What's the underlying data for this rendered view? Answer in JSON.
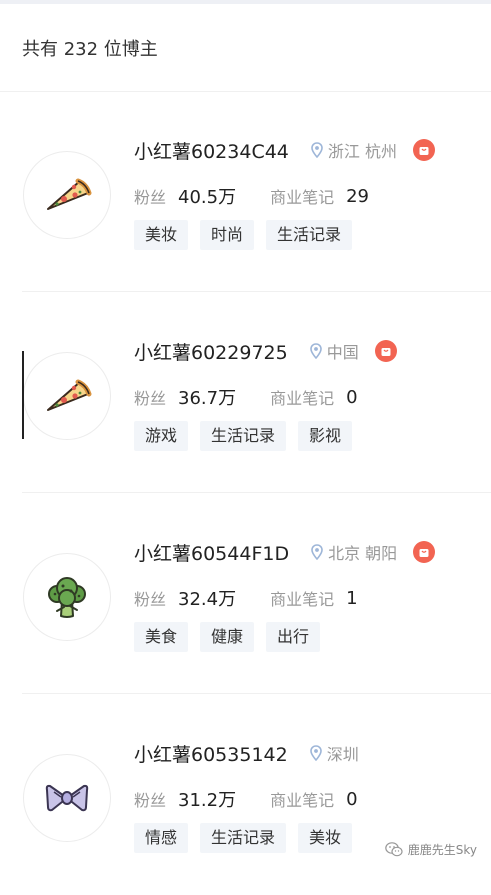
{
  "header": {
    "title": "共有 232 位博主"
  },
  "labels": {
    "fans": "粉丝",
    "notes": "商业笔记"
  },
  "bloggers": [
    {
      "name": "小红薯60234C44",
      "location": "浙江 杭州",
      "fans": "40.5万",
      "notes": "29",
      "avatar": "pizza-icon",
      "brand_badge": true,
      "tags": [
        "美妆",
        "时尚",
        "生活记录"
      ]
    },
    {
      "name": "小红薯60229725",
      "location": "中国",
      "fans": "36.7万",
      "notes": "0",
      "avatar": "pizza-icon",
      "brand_badge": true,
      "tags": [
        "游戏",
        "生活记录",
        "影视"
      ]
    },
    {
      "name": "小红薯60544F1D",
      "location": "北京 朝阳",
      "fans": "32.4万",
      "notes": "1",
      "avatar": "broccoli-icon",
      "brand_badge": true,
      "tags": [
        "美食",
        "健康",
        "出行"
      ]
    },
    {
      "name": "小红薯60535142",
      "location": "深圳",
      "fans": "31.2万",
      "notes": "0",
      "avatar": "bow-icon",
      "brand_badge": false,
      "tags": [
        "情感",
        "生活记录",
        "美妆"
      ]
    }
  ],
  "watermark": {
    "text": "鹿鹿先生Sky",
    "icon": "wechat-icon"
  },
  "colors": {
    "badge": "#f26452",
    "location_icon": "#9eb6d8",
    "tag_bg": "#f2f5f9"
  }
}
